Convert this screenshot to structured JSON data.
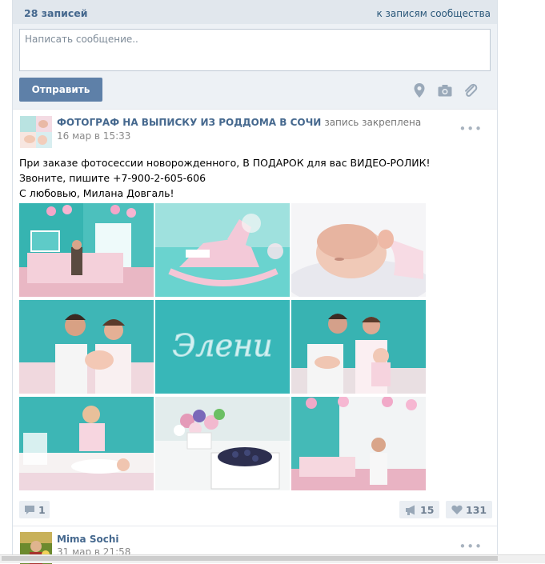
{
  "wall": {
    "count_label": "28 записей",
    "community_link": "к записям сообщества"
  },
  "composer": {
    "placeholder": "Написать сообщение..",
    "send_label": "Отправить",
    "attach_icons": [
      "location-pin-icon",
      "camera-icon",
      "paperclip-icon"
    ]
  },
  "posts": [
    {
      "author": "ФОТОГРАФ НА ВЫПИСКУ ИЗ РОДДОМА В СОЧИ",
      "pinned_label": "запись закреплена",
      "date": "16 мар в 15:33",
      "more": "•••",
      "text_lines": [
        "При заказе фотосессии новорожденного, В ПОДАРОК для вас ВИДЕО-РОЛИК!",
        "Звоните, пишите +7-900-2-605-606",
        "С любовью, Милана Довгаль!"
      ],
      "photo_caption": "Элени",
      "comments": "1",
      "reposts": "15",
      "likes": "131"
    },
    {
      "author": "Mima Sochi",
      "date": "31 мар в 21:58",
      "more": "•••"
    }
  ],
  "colors": {
    "link_blue": "#45688e",
    "header_bg": "#e1e7ed",
    "composer_bg": "#edf1f5",
    "button_blue": "#5e80a8",
    "teal": "#3dbbbd"
  }
}
